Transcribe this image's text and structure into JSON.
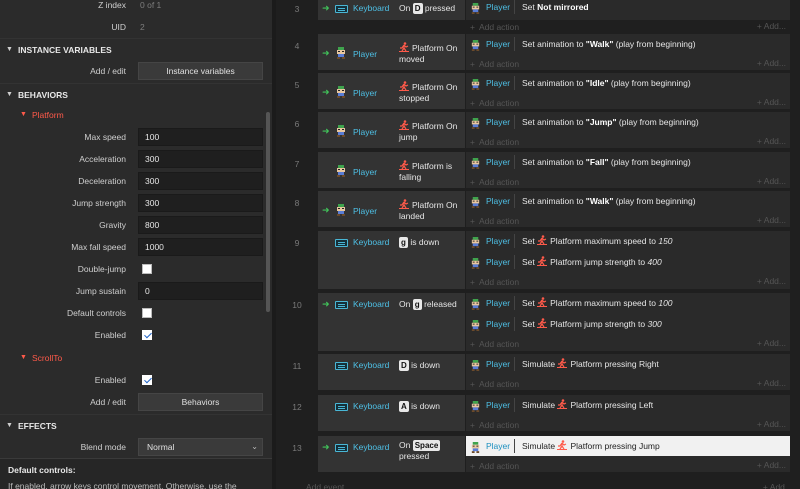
{
  "properties": {
    "z_index_label": "Z index",
    "z_index_value": "0 of 1",
    "uid_label": "UID",
    "uid_value": "2",
    "instance_vars_header": "INSTANCE VARIABLES",
    "add_edit_label": "Add / edit",
    "instance_vars_button": "Instance variables",
    "behaviors_header": "BEHAVIORS",
    "platform_name": "Platform",
    "max_speed_label": "Max speed",
    "max_speed": "100",
    "acceleration_label": "Acceleration",
    "acceleration": "300",
    "deceleration_label": "Deceleration",
    "deceleration": "300",
    "jump_strength_label": "Jump strength",
    "jump_strength": "300",
    "gravity_label": "Gravity",
    "gravity": "800",
    "max_fall_speed_label": "Max fall speed",
    "max_fall_speed": "1000",
    "double_jump_label": "Double-jump",
    "double_jump": false,
    "jump_sustain_label": "Jump sustain",
    "jump_sustain": "0",
    "default_controls_label": "Default controls",
    "default_controls": false,
    "enabled_label": "Enabled",
    "enabled": true,
    "scrollto_name": "ScrollTo",
    "scrollto_enabled_label": "Enabled",
    "scrollto_enabled": true,
    "behaviors_add_edit_label": "Add / edit",
    "behaviors_button": "Behaviors",
    "effects_header": "EFFECTS",
    "blend_mode_label": "Blend mode",
    "blend_mode": "Normal",
    "help_title": "Default controls:",
    "help_text": "If enabled, arrow keys control movement. Otherwise, use the"
  },
  "sheet": {
    "add_action": "Add action",
    "add_more": "+ Add...",
    "add_event": "Add event",
    "events": [
      {
        "num": "3",
        "obj": "Keyboard",
        "cond_pre": "On",
        "key": "D",
        "cond_post": "pressed",
        "actions": [
          {
            "obj": "Player",
            "pre": "Set",
            "bold": "Not mirrored"
          }
        ]
      },
      {
        "num": "4",
        "obj": "Player",
        "beh": "Platform",
        "cond": "On moved",
        "actions": [
          {
            "obj": "Player",
            "pre": "Set animation to ",
            "bold": "\"Walk\"",
            "post": " (play from beginning)"
          }
        ]
      },
      {
        "num": "5",
        "obj": "Player",
        "beh": "Platform",
        "cond": "On stopped",
        "actions": [
          {
            "obj": "Player",
            "pre": "Set animation to ",
            "bold": "\"Idle\"",
            "post": " (play from beginning)"
          }
        ]
      },
      {
        "num": "6",
        "obj": "Player",
        "beh": "Platform",
        "cond": "On jump",
        "actions": [
          {
            "obj": "Player",
            "pre": "Set animation to ",
            "bold": "\"Jump\"",
            "post": " (play from beginning)"
          }
        ]
      },
      {
        "num": "7",
        "obj": "Player",
        "beh": "Platform",
        "cond": "is falling",
        "actions": [
          {
            "obj": "Player",
            "pre": "Set animation to ",
            "bold": "\"Fall\"",
            "post": " (play from beginning)"
          }
        ]
      },
      {
        "num": "8",
        "obj": "Player",
        "beh": "Platform",
        "cond": "On landed",
        "actions": [
          {
            "obj": "Player",
            "pre": "Set animation to ",
            "bold": "\"Walk\"",
            "post": " (play from beginning)"
          }
        ]
      },
      {
        "num": "9",
        "obj": "Keyboard",
        "key": "g",
        "cond_post": "is down",
        "actions": [
          {
            "obj": "Player",
            "pre": "Set",
            "beh": "Platform maximum speed to",
            "val": "150"
          },
          {
            "obj": "Player",
            "pre": "Set",
            "beh": "Platform jump strength to",
            "val": "400"
          }
        ]
      },
      {
        "num": "10",
        "obj": "Keyboard",
        "cond_pre": "On",
        "key": "g",
        "cond_post": "released",
        "actions": [
          {
            "obj": "Player",
            "pre": "Set",
            "beh": "Platform maximum speed to",
            "val": "100"
          },
          {
            "obj": "Player",
            "pre": "Set",
            "beh": "Platform jump strength to",
            "val": "300"
          }
        ]
      },
      {
        "num": "11",
        "obj": "Keyboard",
        "key": "D",
        "cond_post": "is down",
        "actions": [
          {
            "obj": "Player",
            "pre": "Simulate",
            "beh": "Platform pressing Right"
          }
        ]
      },
      {
        "num": "12",
        "obj": "Keyboard",
        "key": "A",
        "cond_post": "is down",
        "actions": [
          {
            "obj": "Player",
            "pre": "Simulate",
            "beh": "Platform pressing Left"
          }
        ]
      },
      {
        "num": "13",
        "obj": "Keyboard",
        "cond_pre": "On",
        "key": "Space",
        "cond_post": "pressed",
        "actions": [
          {
            "obj": "Player",
            "pre": "Simulate",
            "beh": "Platform pressing Jump"
          }
        ]
      }
    ]
  },
  "colors": {
    "accent_object": "#4ec0e6",
    "behavior_red": "#ff5a4a",
    "trigger_green": "#41c25a"
  },
  "icons": {
    "trigger": "green-arrow-icon",
    "keyboard": "keyboard-icon",
    "player": "player-sprite-icon",
    "platform": "platform-behavior-icon"
  }
}
